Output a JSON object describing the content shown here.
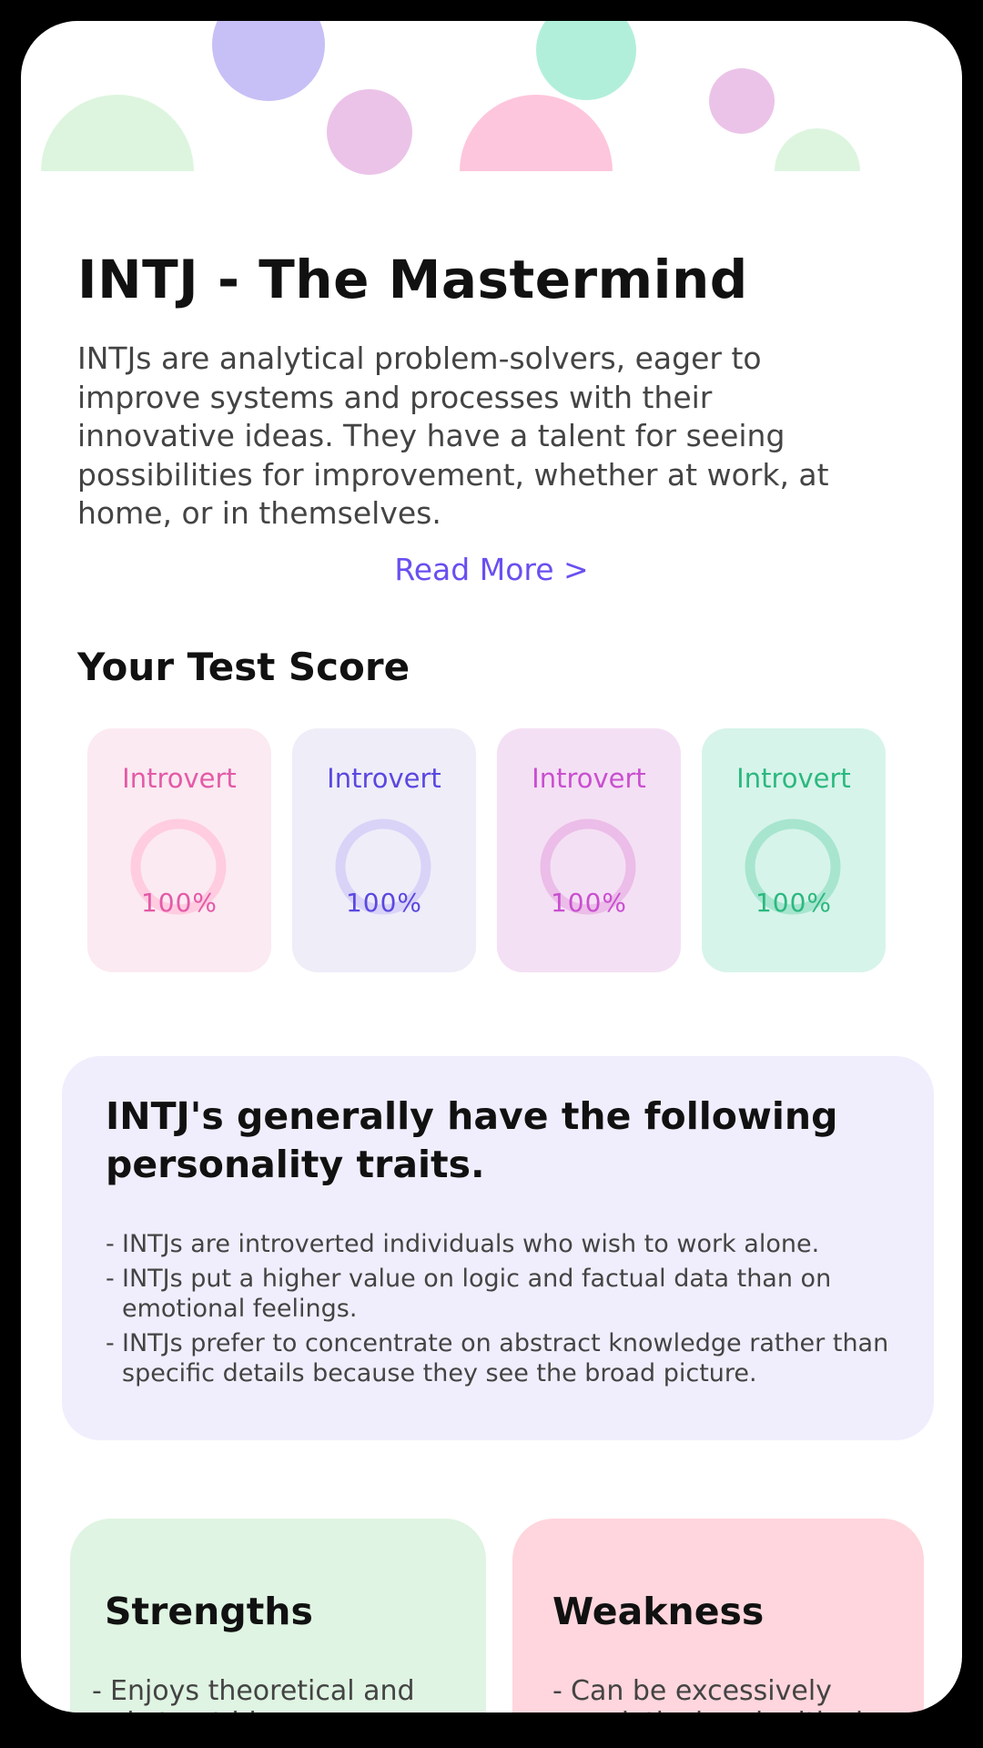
{
  "profile": {
    "title": "INTJ - The Mastermind",
    "description": "INTJs are analytical problem-solvers, eager to improve systems and processes with their innovative ideas. They have a talent for seeing possibilities for improvement, whether at work, at home, or in themselves.",
    "read_more": "Read More >"
  },
  "score": {
    "title": "Your Test Score",
    "cards": [
      {
        "label": "Introvert",
        "percent": "100%",
        "text_color": "#e35aa8",
        "bg_color": "#fbeaf1",
        "ring_color": "#ffcce0"
      },
      {
        "label": "Introvert",
        "percent": "100%",
        "text_color": "#5a48e0",
        "bg_color": "#efedf8",
        "ring_color": "#d9d3f8"
      },
      {
        "label": "Introvert",
        "percent": "100%",
        "text_color": "#c94fd0",
        "bg_color": "#f4e0f4",
        "ring_color": "#ebbde8"
      },
      {
        "label": "Introvert",
        "percent": "100%",
        "text_color": "#2cb87f",
        "bg_color": "#d7f4ea",
        "ring_color": "#a7e5cf"
      }
    ]
  },
  "traits": {
    "heading": "INTJ's generally have the following personality traits.",
    "items": [
      {
        "dash": "-",
        "text": "INTJs are introverted individuals who wish to work alone."
      },
      {
        "dash": "-",
        "text": "INTJs put a higher value on logic and factual data than on emotional feelings."
      },
      {
        "dash": "-",
        "text": "INTJs prefer to concentrate on abstract knowledge rather than specific details because they see the broad picture."
      }
    ]
  },
  "strengths": {
    "heading": "Strengths",
    "dash": "-",
    "first_item": "Enjoys theoretical and abstract ideas"
  },
  "weakness": {
    "heading": "Weakness",
    "dash": "-",
    "first_item": "Can be excessively analytical and critical"
  },
  "colors": {
    "accent": "#6a4ff0",
    "traits_bg": "#f0eefc",
    "strengths_bg": "#dff4e2",
    "weakness_bg": "#ffd6dd"
  }
}
